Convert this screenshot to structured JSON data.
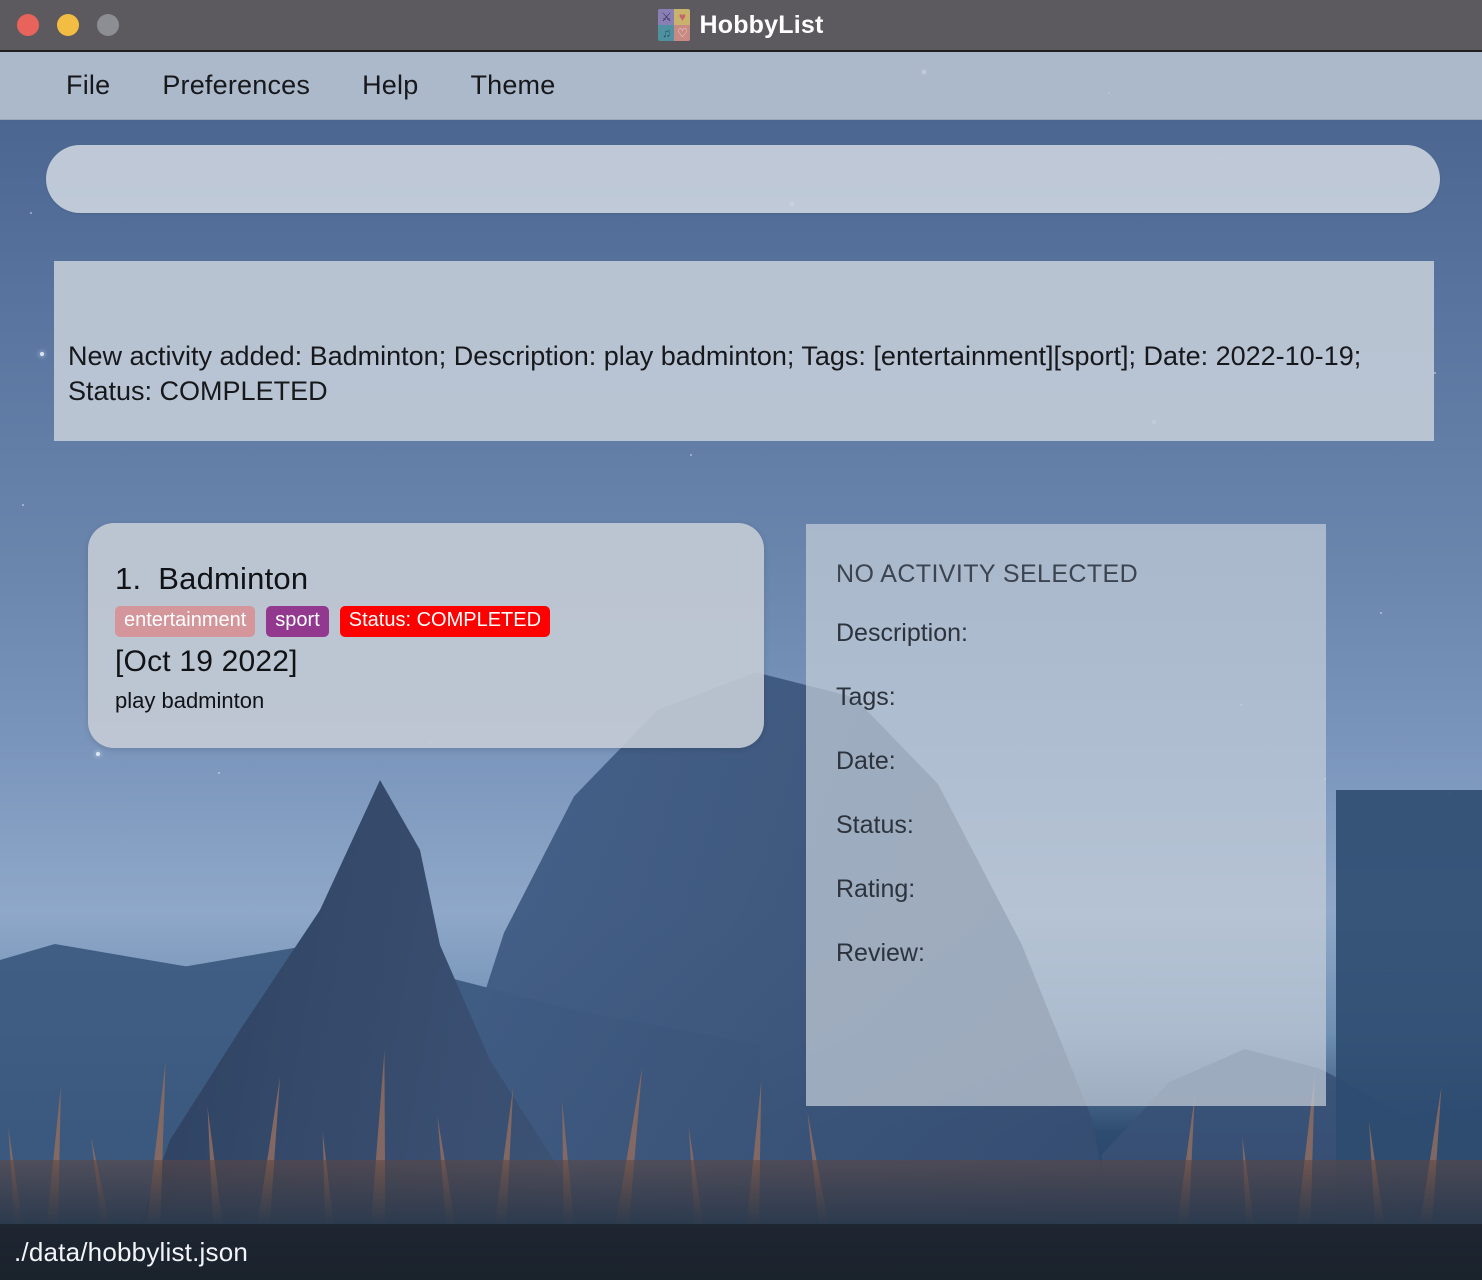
{
  "window": {
    "title": "HobbyList",
    "app_icon_name": "hobbylist-icon",
    "traffic_lights": {
      "close_label": "close",
      "minimize_label": "minimize",
      "zoom_label": "zoom",
      "close_color": "#e8635b",
      "minimize_color": "#f2bd42",
      "zoom_color": "#8d8e93"
    },
    "icon_tiles": [
      {
        "glyph": "⚔",
        "bg": "#8a7fb5"
      },
      {
        "glyph": "♥",
        "bg": "#c9b26b"
      },
      {
        "glyph": "♫",
        "bg": "#4e91a0"
      },
      {
        "glyph": "♡",
        "bg": "#c98a84"
      }
    ]
  },
  "menu": {
    "items": [
      {
        "label": "File"
      },
      {
        "label": "Preferences"
      },
      {
        "label": "Help"
      },
      {
        "label": "Theme"
      }
    ]
  },
  "command": {
    "value": "",
    "placeholder": ""
  },
  "result": {
    "text": "New activity added: Badminton; Description: play badminton; Tags: [entertainment][sport]; Date: 2022-10-19; Status: COMPLETED"
  },
  "activity_list": {
    "items": [
      {
        "index": "1.",
        "name": "Badminton",
        "date": "[Oct 19 2022]",
        "description": "play badminton",
        "chips": [
          {
            "label": "entertainment",
            "color": "#d4969b"
          },
          {
            "label": "sport",
            "color": "#92388f"
          },
          {
            "label": "Status: COMPLETED",
            "color": "#fe0000"
          }
        ]
      }
    ]
  },
  "detail_panel": {
    "heading": "NO ACTIVITY SELECTED",
    "fields": [
      {
        "label": "Description:"
      },
      {
        "label": "Tags:"
      },
      {
        "label": "Date:"
      },
      {
        "label": "Status:"
      },
      {
        "label": "Rating:"
      },
      {
        "label": "Review:"
      }
    ]
  },
  "status_bar": {
    "path": "./data/hobbylist.json"
  }
}
